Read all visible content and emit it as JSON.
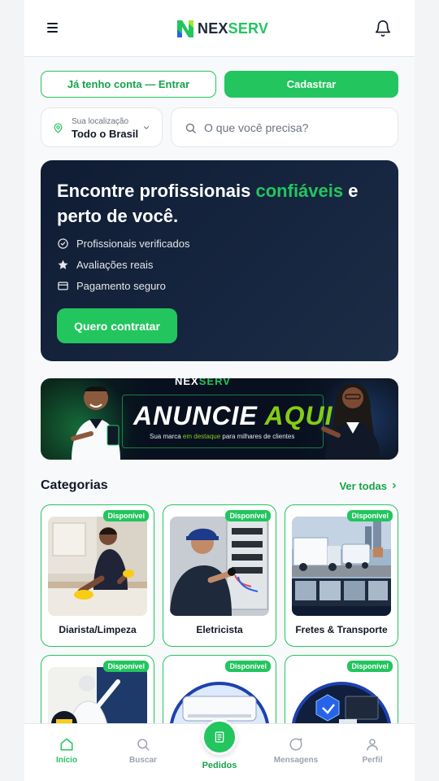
{
  "header": {
    "logo_part1": "NEX",
    "logo_part2": "SERV",
    "menu_icon": "hamburger-menu-icon",
    "bell_icon": "bell-icon"
  },
  "auth": {
    "login_label": "Já tenho conta — Entrar",
    "signup_label": "Cadastrar"
  },
  "location": {
    "label": "Sua localização",
    "value": "Todo o Brasil"
  },
  "search": {
    "placeholder": "O que você precisa?"
  },
  "hero": {
    "title_part1": "Encontre profissionais ",
    "title_highlight": "confiáveis",
    "title_part2": " e perto de você.",
    "features": [
      {
        "icon": "check-circle-icon",
        "label": "Profissionais verificados"
      },
      {
        "icon": "star-icon",
        "label": "Avaliações reais"
      },
      {
        "icon": "credit-card-icon",
        "label": "Pagamento seguro"
      }
    ],
    "cta_label": "Quero contratar"
  },
  "ad_banner": {
    "brand_part1": "NEX",
    "brand_part2": "SERV",
    "headline_part1": "ANUNCIE ",
    "headline_part2": "AQUI",
    "sub_part1": "Sua marca ",
    "sub_highlight": "em destaque",
    "sub_part2": " para milhares de clientes"
  },
  "categories": {
    "title": "Categorias",
    "see_all": "Ver todas",
    "items": [
      {
        "name": "Diarista/Limpeza",
        "badge": "Disponível"
      },
      {
        "name": "Eletricista",
        "badge": "Disponível"
      },
      {
        "name": "Fretes & Transporte",
        "badge": "Disponível"
      },
      {
        "name": "",
        "badge": "Disponível"
      },
      {
        "name": "",
        "badge": "Disponível"
      },
      {
        "name": "",
        "badge": "Disponível"
      }
    ]
  },
  "bottom_nav": {
    "items": [
      {
        "label": "Início",
        "icon": "home-icon"
      },
      {
        "label": "Buscar",
        "icon": "search-icon"
      },
      {
        "label": "Pedidos",
        "icon": "document-icon"
      },
      {
        "label": "Mensagens",
        "icon": "chat-bubble-icon"
      },
      {
        "label": "Perfil",
        "icon": "user-icon"
      }
    ]
  },
  "colors": {
    "brand_green": "#22c55e",
    "hero_bg": "#0f1c33"
  }
}
